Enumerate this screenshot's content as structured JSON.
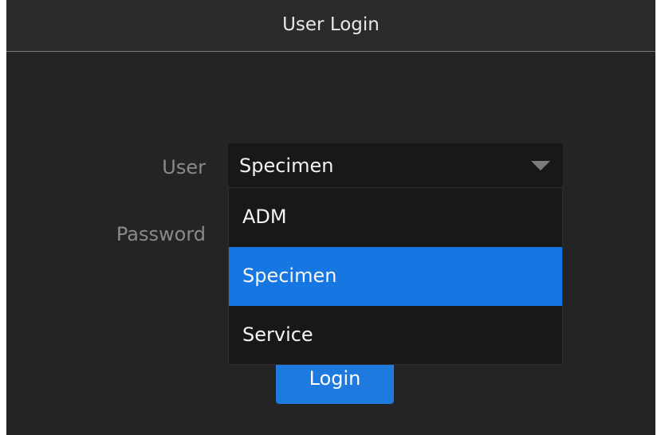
{
  "dialog": {
    "title": "User Login"
  },
  "form": {
    "user_label": "User",
    "password_label": "Password",
    "user_select": {
      "value": "Specimen",
      "options": [
        "ADM",
        "Specimen",
        "Service"
      ],
      "selected_index": 1
    },
    "login_label": "Login"
  },
  "icons": {
    "dropdown": "chevron-down-icon"
  },
  "colors": {
    "background": "#242424",
    "field_background": "#181818",
    "accent": "#1677e3",
    "label_text": "#8a8a8a"
  }
}
